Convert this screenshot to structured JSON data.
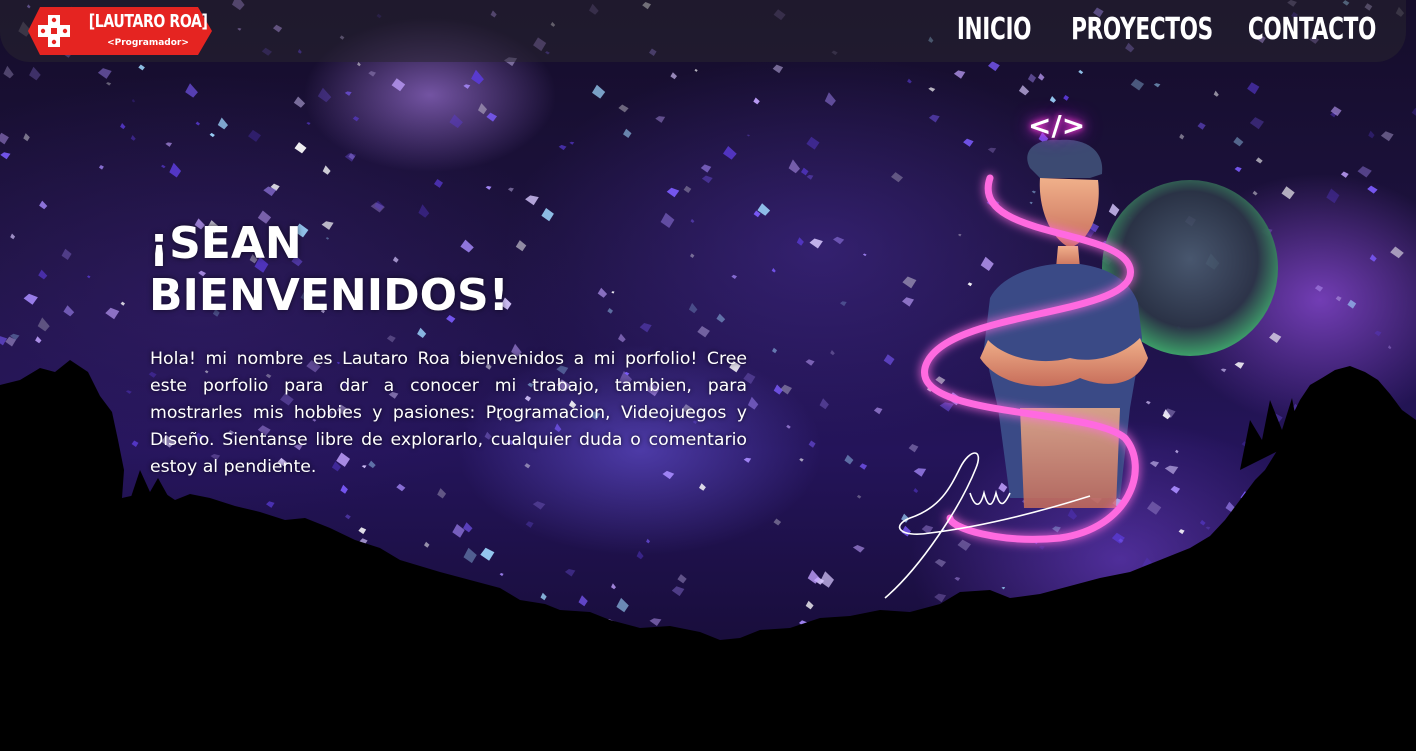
{
  "header": {
    "logo": {
      "title": "[LAUTARO ROA]",
      "subtitle": "<Programador>",
      "icon": "red-cross-icon",
      "accent_color": "#e52421"
    },
    "nav": [
      {
        "label": "INICIO"
      },
      {
        "label": "PROYECTOS"
      },
      {
        "label": "CONTACTO"
      }
    ]
  },
  "hero": {
    "title_line1": "¡SEAN",
    "title_line2": "BIENVENIDOS!",
    "body": "Hola! mi nombre es Lautaro Roa bienvenidos a mi porfolio! Cree este porfolio para dar a conocer mi trabajo, tambien, para mostrarles mis hobbies y pasiones: Programacion, Videojuegos y Diseño. Sientanse libre de explorarlo, cualquier duda o comentario estoy al pendiente."
  },
  "portrait": {
    "code_symbol": "</>",
    "icon": "code-icon",
    "neon_color": "#ff3ad6"
  },
  "colors": {
    "background": "#1d1240",
    "text": "#ffffff",
    "header_bg": "#28242f"
  }
}
